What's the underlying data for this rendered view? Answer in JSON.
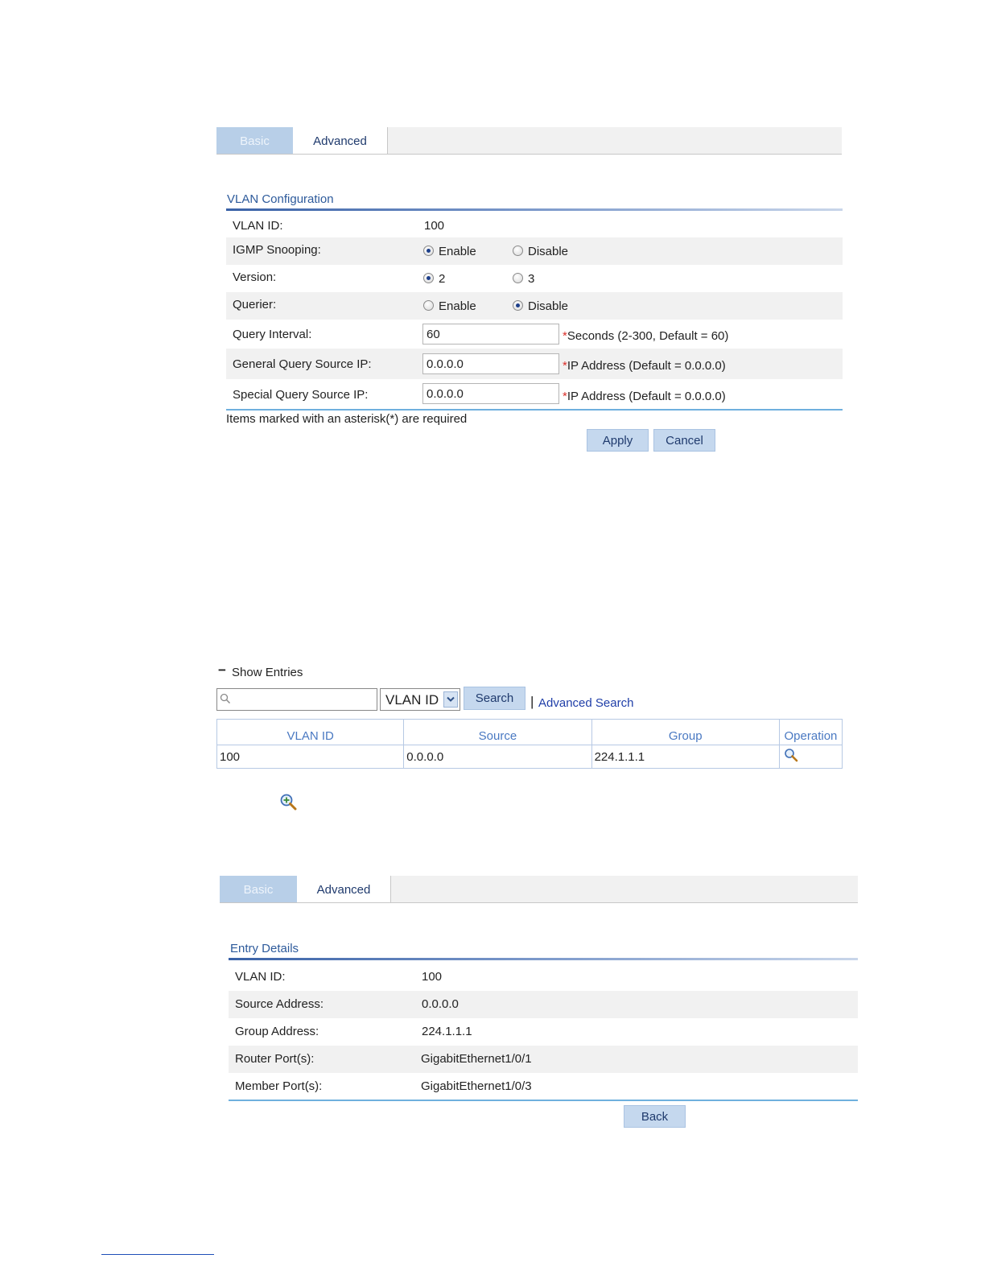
{
  "form1": {
    "tabs": [
      "Basic",
      "Advanced"
    ],
    "section_title": "VLAN Configuration",
    "rows": {
      "vlan_id": {
        "label": "VLAN ID:",
        "value": "100"
      },
      "igmp_snooping": {
        "label": "IGMP Snooping:",
        "options": [
          "Enable",
          "Disable"
        ],
        "selected": "Enable"
      },
      "version": {
        "label": "Version:",
        "options": [
          "2",
          "3"
        ],
        "selected": "2"
      },
      "querier": {
        "label": "Querier:",
        "options": [
          "Enable",
          "Disable"
        ],
        "selected": "Disable"
      },
      "query_interval": {
        "label": "Query Interval:",
        "value": "60",
        "hint": "Seconds (2-300, Default = 60)"
      },
      "general_query_source_ip": {
        "label": "General Query Source IP:",
        "value": "0.0.0.0",
        "hint": "IP Address (Default = 0.0.0.0)"
      },
      "special_query_source_ip": {
        "label": "Special Query Source IP:",
        "value": "0.0.0.0",
        "hint": "IP Address (Default = 0.0.0.0)"
      }
    },
    "asterisk": "*",
    "required_note": "Items marked with an asterisk(*) are required",
    "apply_label": "Apply",
    "cancel_label": "Cancel"
  },
  "entries": {
    "toggle_symbol": "−",
    "title": "Show Entries",
    "search_value": "",
    "filter_selected": "VLAN ID",
    "search_label": "Search",
    "separator": "|",
    "advanced_search_label": "Advanced Search",
    "columns": [
      "VLAN ID",
      "Source",
      "Group",
      "Operation"
    ],
    "rows": [
      {
        "vlan_id": "100",
        "source": "0.0.0.0",
        "group": "224.1.1.1",
        "operation": "magnifier-icon"
      }
    ]
  },
  "form2": {
    "tabs": [
      "Basic",
      "Advanced"
    ],
    "section_title": "Entry Details",
    "details": [
      {
        "label": "VLAN ID:",
        "value": "100"
      },
      {
        "label": "Source Address:",
        "value": "0.0.0.0"
      },
      {
        "label": "Group Address:",
        "value": "224.1.1.1"
      },
      {
        "label": "Router Port(s):",
        "value": "GigabitEthernet1/0/1"
      },
      {
        "label": "Member Port(s):",
        "value": "GigabitEthernet1/0/3"
      }
    ],
    "back_label": "Back"
  },
  "colors": {
    "accent": "#2d5a9b",
    "tab_active": "#b8cfe8",
    "button": "#c5d8ee",
    "required": "#d9302b"
  }
}
